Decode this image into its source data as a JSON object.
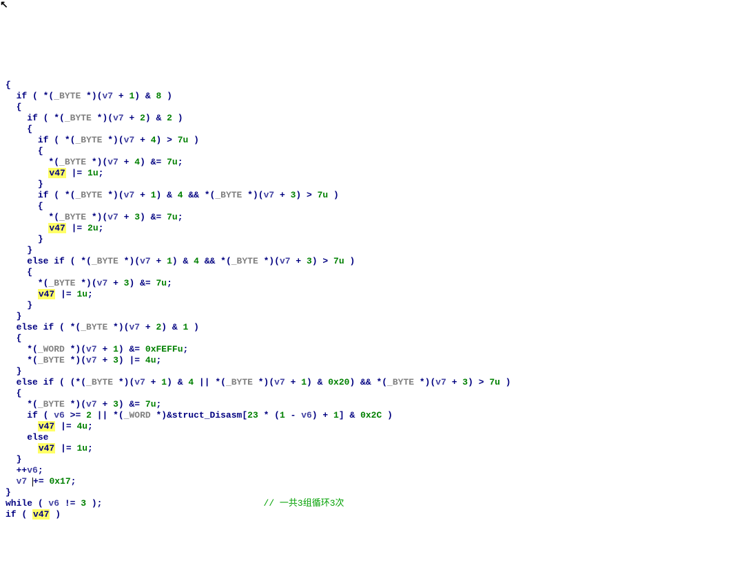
{
  "code": {
    "l1": "{",
    "l2_if": "if",
    "l2_ty": "_BYTE",
    "l2_var": "v7",
    "l2_n1": "1",
    "l2_n8": "8",
    "l3": "{",
    "l4_if": "if",
    "l4_ty": "_BYTE",
    "l4_var": "v7",
    "l4_n2a": "2",
    "l4_n2b": "2",
    "l5": "{",
    "l6_if": "if",
    "l6_ty": "_BYTE",
    "l6_var": "v7",
    "l6_n4": "4",
    "l6_n7u": "7u",
    "l7": "{",
    "l8_ty": "_BYTE",
    "l8_var": "v7",
    "l8_n4": "4",
    "l8_n7u": "7u",
    "l9_hl": "v47",
    "l9_n1u": "1u",
    "l10": "}",
    "l11_if": "if",
    "l11_ty1": "_BYTE",
    "l11_var1": "v7",
    "l11_n1": "1",
    "l11_n4": "4",
    "l11_ty2": "_BYTE",
    "l11_var2": "v7",
    "l11_n3": "3",
    "l11_n7u": "7u",
    "l12": "{",
    "l13_ty": "_BYTE",
    "l13_var": "v7",
    "l13_n3": "3",
    "l13_n7u": "7u",
    "l14_hl": "v47",
    "l14_n2u": "2u",
    "l15": "}",
    "l16": "}",
    "l17_else": "else if",
    "l17_ty1": "_BYTE",
    "l17_var1": "v7",
    "l17_n1": "1",
    "l17_n4": "4",
    "l17_ty2": "_BYTE",
    "l17_var2": "v7",
    "l17_n3": "3",
    "l17_n7u": "7u",
    "l18": "{",
    "l19_ty": "_BYTE",
    "l19_var": "v7",
    "l19_n3": "3",
    "l19_n7u": "7u",
    "l20_hl": "v47",
    "l20_n1u": "1u",
    "l21": "}",
    "l22": "}",
    "l23_else": "else if",
    "l23_ty": "_BYTE",
    "l23_var": "v7",
    "l23_n2": "2",
    "l23_n1": "1",
    "l24": "{",
    "l25_ty": "_WORD",
    "l25_var": "v7",
    "l25_n1": "1",
    "l25_hex": "0xFEFFu",
    "l26_ty": "_BYTE",
    "l26_var": "v7",
    "l26_n3": "3",
    "l26_n4u": "4u",
    "l27": "}",
    "l28_else": "else if",
    "l28_ty1": "_BYTE",
    "l28_var1": "v7",
    "l28_n1a": "1",
    "l28_n4": "4",
    "l28_ty2": "_BYTE",
    "l28_var2": "v7",
    "l28_n1b": "1",
    "l28_hex20": "0x20",
    "l28_ty3": "_BYTE",
    "l28_var3": "v7",
    "l28_n3": "3",
    "l28_n7u": "7u",
    "l29": "{",
    "l30_ty": "_BYTE",
    "l30_var": "v7",
    "l30_n3": "3",
    "l30_n7u": "7u",
    "l31_if": "if",
    "l31_v6": "v6",
    "l31_n2": "2",
    "l31_ty": "_WORD",
    "l31_struct": "struct_Disasm",
    "l31_n23": "23",
    "l31_n1a": "1",
    "l31_v6b": "v6",
    "l31_n1b": "1",
    "l31_hex2c": "0x2C",
    "l32_hl": "v47",
    "l32_n4u": "4u",
    "l33_else": "else",
    "l34_hl": "v47",
    "l34_n1u": "1u",
    "l35": "}",
    "l36_pp": "++",
    "l36_v6": "v6",
    "l37_v7": "v7",
    "l37_hex17": "0x17",
    "l38": "}",
    "l39_while": "while",
    "l39_v6": "v6",
    "l39_n3": "3",
    "l39_cmt": "// 一共3组循环3次",
    "l40_if": "if",
    "l40_hl": "v47"
  }
}
